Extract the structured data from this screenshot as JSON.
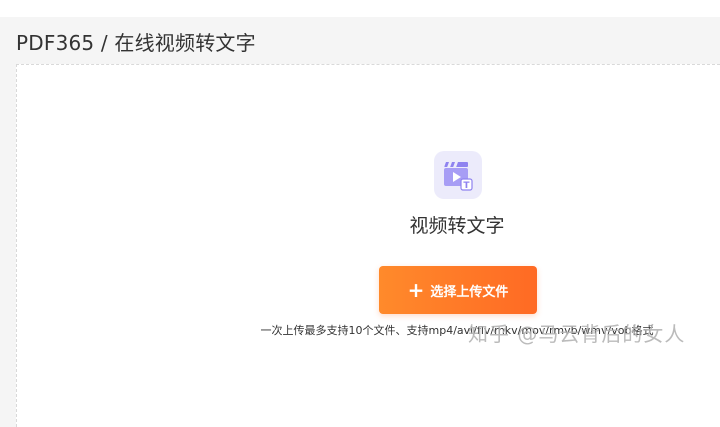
{
  "header": {
    "breadcrumb": "PDF365 / 在线视频转文字"
  },
  "upload_panel": {
    "icon": "video-to-text-icon",
    "title": "视频转文字",
    "upload_button": {
      "icon": "plus-icon",
      "plus_glyph": "+",
      "label": "选择上传文件"
    },
    "hint": "一次上传最多支持10个文件、支持mp4/avi/flv/mkv/mov/rmvb/wmv/vob格式"
  },
  "watermark": "知乎 @马云背后的女人",
  "colors": {
    "accent_orange": "#ff7a2a",
    "icon_tile_bg": "#ecebfb",
    "icon_purple": "#8f83f0"
  }
}
